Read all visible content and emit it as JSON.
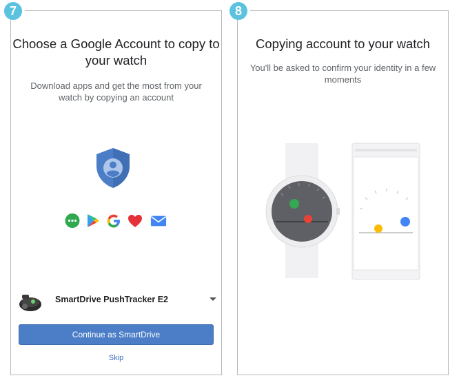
{
  "steps": {
    "left": {
      "number": "7",
      "title": "Choose a Google Account to copy to your watch",
      "subtitle": "Download apps and get the most from your watch by copying an account",
      "account_name": "SmartDrive PushTracker E2",
      "continue_label": "Continue as SmartDrive",
      "skip_label": "Skip",
      "app_icons": [
        "messages-icon",
        "play-store-icon",
        "google-icon",
        "heart-icon",
        "mail-icon"
      ]
    },
    "right": {
      "number": "8",
      "title": "Copying account to your watch",
      "subtitle": "You'll be asked to confirm your identity in a few moments"
    }
  },
  "colors": {
    "badge": "#5bc3df",
    "primary_button": "#4b7ec6",
    "shield": "#4b7ec6",
    "watch_face": "#5f6065",
    "green_dot": "#34a853",
    "red_dot": "#ea4335",
    "yellow_dot": "#fbbc05",
    "blue_dot": "#4285f4"
  }
}
